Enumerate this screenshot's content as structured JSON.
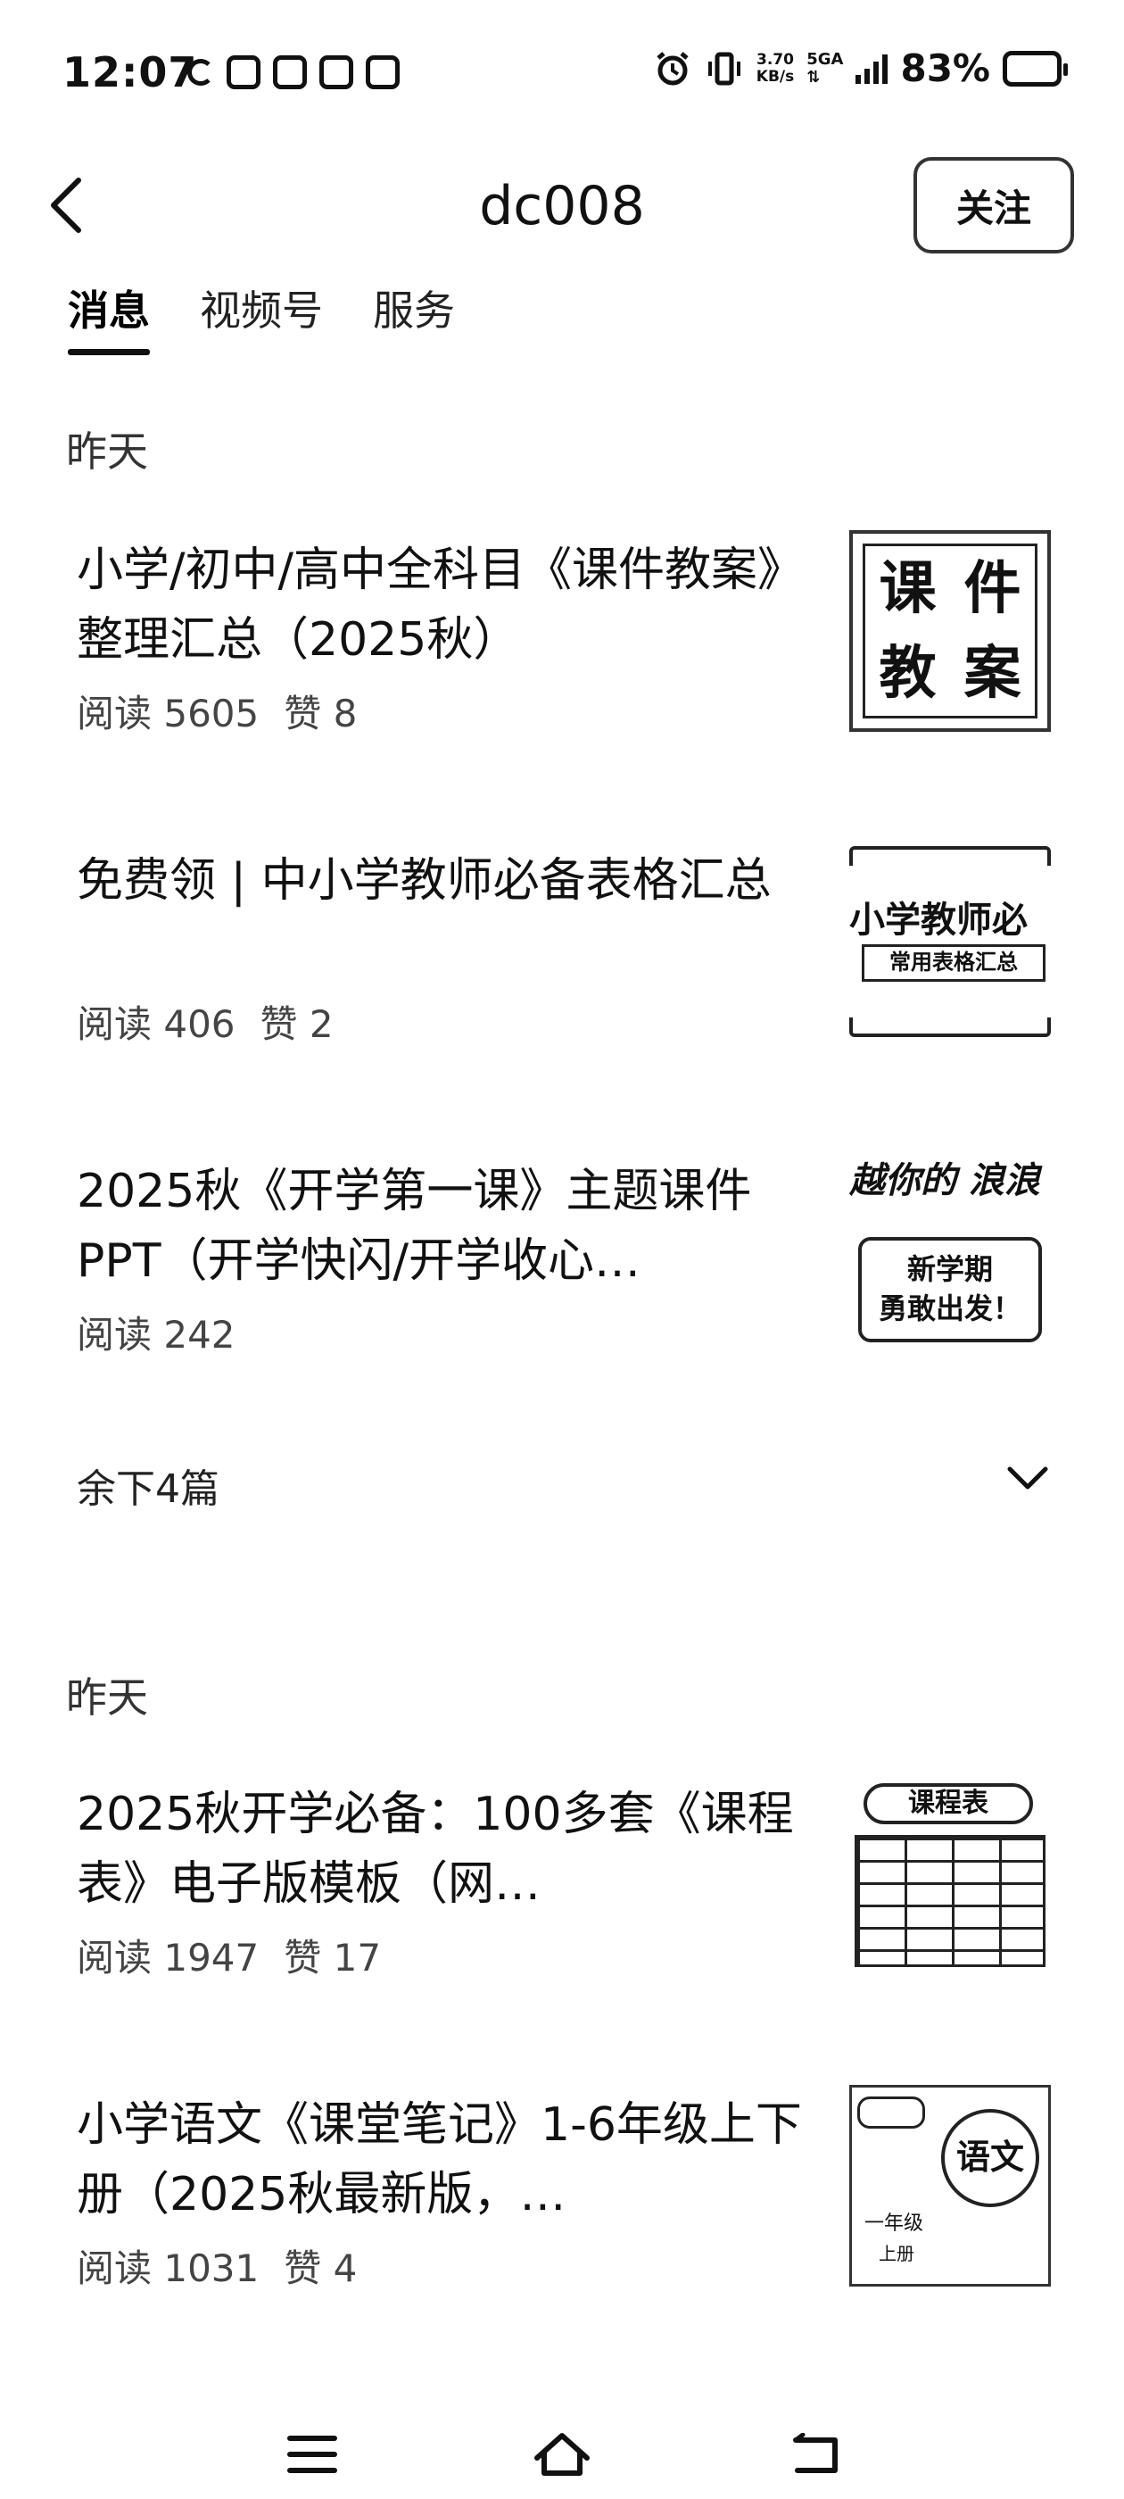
{
  "status_bar": {
    "time": "12:07",
    "speed_value": "3.70",
    "speed_unit": "KB/s",
    "network": "5GA",
    "battery_percent": "83%"
  },
  "header": {
    "title": "dc008",
    "follow_label": "关注"
  },
  "tabs": [
    {
      "label": "消息",
      "active": true
    },
    {
      "label": "视频号",
      "active": false
    },
    {
      "label": "服务",
      "active": false
    }
  ],
  "groups": [
    {
      "date": "昨天",
      "articles": [
        {
          "title": "小学/初中/高中全科目《课件教案》整理汇总（2025秋）",
          "read": "阅读 5605",
          "likes": "赞 8",
          "thumb": {
            "chars": [
              "课",
              "件",
              "教",
              "案"
            ]
          }
        },
        {
          "title": "免费领 | 中小学教师必备表格汇总",
          "read": "阅读 406",
          "likes": "赞 2",
          "thumb": {
            "big": "小学教师必",
            "box": "常用表格汇总"
          }
        },
        {
          "title": "2025秋《开学第一课》主题课件PPT（开学快闪/开学收心…",
          "read": "阅读 242",
          "likes": "",
          "thumb": {
            "top": "越你的 浪浪",
            "line1": "新学期",
            "line2": "勇敢出发！"
          }
        }
      ],
      "more_label": "余下4篇"
    },
    {
      "date": "昨天",
      "articles": [
        {
          "title": "2025秋开学必备：100多套《课程表》电子版模板（网…",
          "read": "阅读 1947",
          "likes": "赞 17",
          "thumb": {
            "head": "课程表"
          }
        },
        {
          "title": "小学语文《课堂笔记》1-6年级上下册（2025秋最新版，…",
          "read": "阅读 1031",
          "likes": "赞 4",
          "thumb": {
            "circle": "语文",
            "grade": "一年级",
            "vol": "上册"
          }
        }
      ]
    }
  ]
}
